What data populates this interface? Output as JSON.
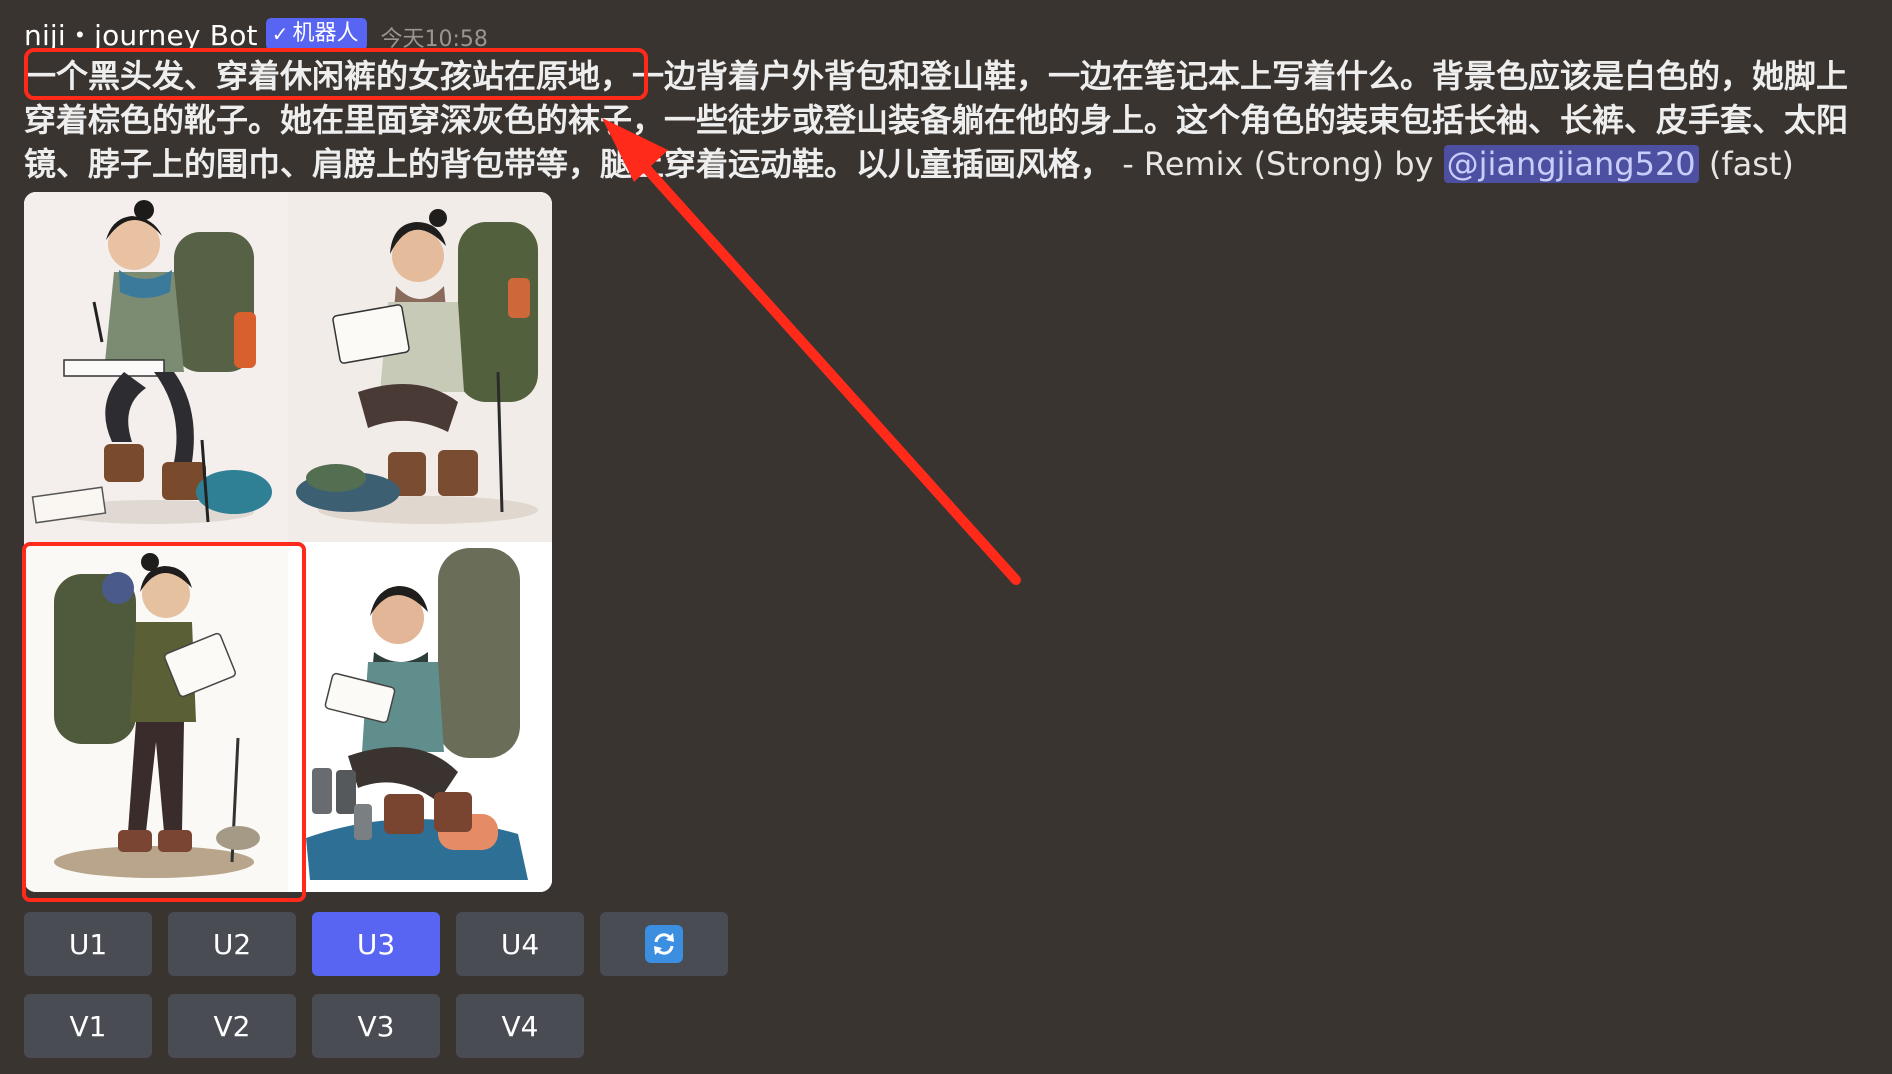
{
  "header": {
    "username": "niji・journey Bot",
    "badge_check": "✓",
    "badge_label": "机器人",
    "timestamp": "今天10:58"
  },
  "message": {
    "prompt_highlighted": "一个黑头发、穿着休闲裤的女孩站在原地，",
    "prompt_rest": "一边背着户外背包和登山鞋，一边在笔记本上写着什么。背景色应该是白色的，她脚上穿着棕色的靴子。她在里面穿深灰色的袜子，一些徒步或登山装备躺在他的身上。这个角色的装束包括长袖、长裤、皮手套、太阳镜、脖子上的围巾、肩膀上的背包带等，腿上穿着运动鞋。以儿童插画风格，",
    "suffix": " - Remix (Strong) by ",
    "mention": "@jiangjiang520",
    "speed": " (fast)"
  },
  "image_grid": {
    "tiles": [
      "girl-sketching-seated",
      "girl-crouching-notebook",
      "girl-standing-backpack",
      "girl-squatting-map"
    ],
    "selected_tile": 3
  },
  "buttons": {
    "upscale": [
      "U1",
      "U2",
      "U3",
      "U4"
    ],
    "variation": [
      "V1",
      "V2",
      "V3",
      "V4"
    ],
    "active": "U3",
    "reroll_icon": "refresh-icon"
  },
  "annotation": {
    "color": "#ff2a1a"
  },
  "colors": {
    "background": "#3a3430",
    "button": "#4a4c53",
    "accent": "#5865f2",
    "mention_bg": "#4d4fa0"
  }
}
